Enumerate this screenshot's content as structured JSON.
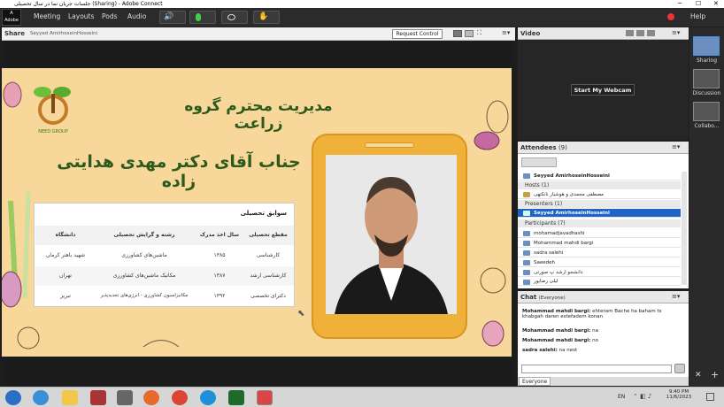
{
  "window": {
    "title": "جلسات جریان نما در سال تحصیلی (Sharing) - Adobe Connect"
  },
  "menu": {
    "logo_text": "Adobe",
    "items": [
      "Meeting",
      "Layouts",
      "Pods",
      "Audio"
    ],
    "help": "Help"
  },
  "share": {
    "title": "Share",
    "presenter": "Seyyed AmirhoseinHosseini",
    "request_control": "Request Control"
  },
  "slide": {
    "title": "مدیریت محترم گروه زراعت",
    "name": "جناب آقای دکتر مهدی هدایتی زاده",
    "logo_caption": "NEED GROUP",
    "table": {
      "caption": "سوابق تحصیلی",
      "headers": [
        "مقطع تحصیلی",
        "سال اخذ مدرک",
        "رشته و گرایش تحصیلی",
        "دانشگاه"
      ],
      "rows": [
        [
          "کارشناسی",
          "۱۳۸۵",
          "ماشین‌های کشاورزی",
          "شهید باهنر کرمان"
        ],
        [
          "کارشناسی ارشد",
          "۱۳۸۷",
          "مکانیک ماشین‌های کشاورزی",
          "تهران"
        ],
        [
          "دکترای تخصصی",
          "۱۳۹۲",
          "مکانیزاسیون کشاورزی - انرژی‌های تجدیدپذیر",
          "تبریز"
        ]
      ]
    }
  },
  "video": {
    "title": "Video",
    "webcam_button": "Start My Webcam"
  },
  "attendees": {
    "title": "Attendees",
    "count": "(9)",
    "self": "Seyyed AmirhoseinHosseini",
    "hosts_label": "Hosts (1)",
    "hosts": [
      "مصطفی محمدی و هوشیار نانکتهی"
    ],
    "presenters_label": "Presenters (1)",
    "presenters": [
      "Seyyed AmirhoseinHosseini"
    ],
    "participants_label": "Participants (7)",
    "participants": [
      "mohamadjavadhashi",
      "Mohammad mahdi bargi",
      "sadra salehi",
      "Saeedeh",
      "دانشجو ارشد پ صورتی",
      "لیلی رضاپور"
    ]
  },
  "chat": {
    "title": "Chat",
    "scope": "(Everyone)",
    "messages": [
      {
        "user": "Mohammad mahdi bargi:",
        "text": "ehteram Bache ha baham ts khabgah daren estefadem konan"
      },
      {
        "user": "Mohammad mahdi bargi:",
        "text": "na"
      },
      {
        "user": "Mohammad mahdi bargi:",
        "text": "no"
      },
      {
        "user": "sadra salehi:",
        "text": "na nest"
      }
    ],
    "tab": "Everyone"
  },
  "rail": {
    "items": [
      "Sharing",
      "Discussion",
      "Collabo..."
    ]
  },
  "taskbar": {
    "lang": "EN",
    "time": "9:40 PM",
    "date": "11/6/2023"
  }
}
